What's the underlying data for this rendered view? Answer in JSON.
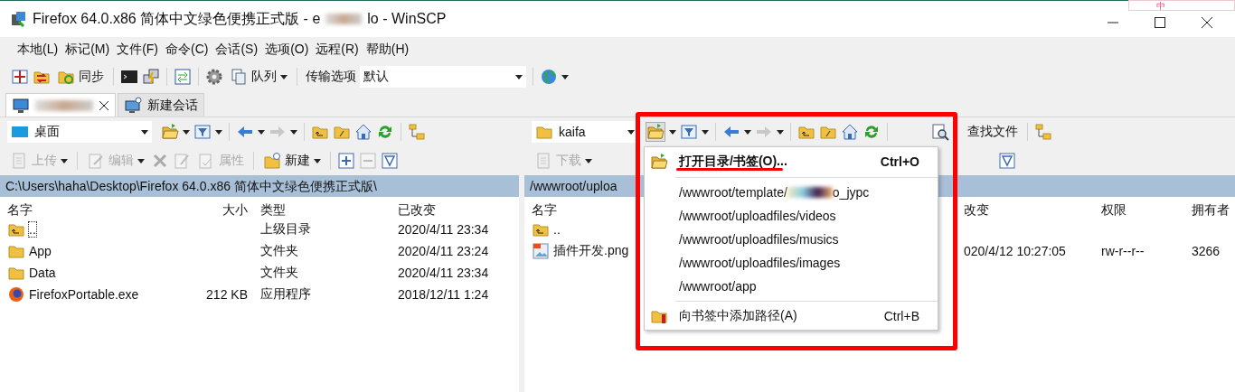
{
  "window": {
    "title_start": "Firefox 64.0.x86 简体中文绿色便携正式版 - e",
    "title_end": "lo - WinSCP",
    "ime_label": "中"
  },
  "menu_bar": [
    "本地(L)",
    "标记(M)",
    "文件(F)",
    "命令(C)",
    "会话(S)",
    "选项(O)",
    "远程(R)",
    "帮助(H)"
  ],
  "toolbar": {
    "sync_label": "同步",
    "queue_label": "队列",
    "transfer_label": "传输选项",
    "transfer_value": "默认"
  },
  "session_tabs": [
    {
      "selected": true,
      "closable": true
    },
    {
      "label": "新建会话",
      "selected": false,
      "closable": false
    }
  ],
  "left_panel": {
    "location": "桌面",
    "actions": [
      {
        "kind": "upload",
        "label": "上传",
        "disabled": true
      },
      {
        "kind": "edit",
        "label": "编辑",
        "disabled": true
      },
      {
        "kind": "props",
        "label": "属性",
        "disabled": true
      },
      {
        "kind": "new",
        "label": "新建",
        "disabled": false
      }
    ],
    "path": "C:\\Users\\haha\\Desktop\\Firefox 64.0.x86 简体中文绿色便携正式版\\",
    "columns": [
      "名字",
      "大小",
      "类型",
      "已改变"
    ],
    "rows": [
      {
        "kind": "parent",
        "name": "..",
        "type": "上级目录",
        "modified": "2020/4/11  23:34"
      },
      {
        "kind": "folder",
        "name": "App",
        "type": "文件夹",
        "modified": "2020/4/11  23:24"
      },
      {
        "kind": "folder",
        "name": "Data",
        "type": "文件夹",
        "modified": "2020/4/11  23:34"
      },
      {
        "kind": "exe",
        "name": "FirefoxPortable.exe",
        "size": "212 KB",
        "type": "应用程序",
        "modified": "2018/12/11  1:24"
      }
    ]
  },
  "right_panel": {
    "location": "kaifa",
    "find_label": "查找文件",
    "actions": [
      {
        "kind": "download",
        "label": "下载",
        "disabled": true
      }
    ],
    "path": "/wwwroot/uploa",
    "columns": [
      "名字",
      "改变",
      "权限",
      "拥有者"
    ],
    "rows": [
      {
        "kind": "parent",
        "name": ".."
      },
      {
        "kind": "image",
        "name": "插件开发.png",
        "modified": "020/4/12 10:27:05",
        "rights": "rw-r--r--",
        "owner": "3266"
      }
    ]
  },
  "dropdown_menu": [
    {
      "kind": "header",
      "label": "打开目录/书签(O)...",
      "shortcut": "Ctrl+O"
    },
    {
      "kind": "path",
      "label": "/wwwroot/template/",
      "label_after_redaction": "o_jypc"
    },
    {
      "kind": "path",
      "label": "/wwwroot/uploadfiles/videos"
    },
    {
      "kind": "path",
      "label": "/wwwroot/uploadfiles/musics"
    },
    {
      "kind": "path",
      "label": "/wwwroot/uploadfiles/images"
    },
    {
      "kind": "path",
      "label": "/wwwroot/app"
    },
    {
      "kind": "action",
      "label": "向书签中添加路径(A)",
      "shortcut": "Ctrl+B"
    }
  ]
}
